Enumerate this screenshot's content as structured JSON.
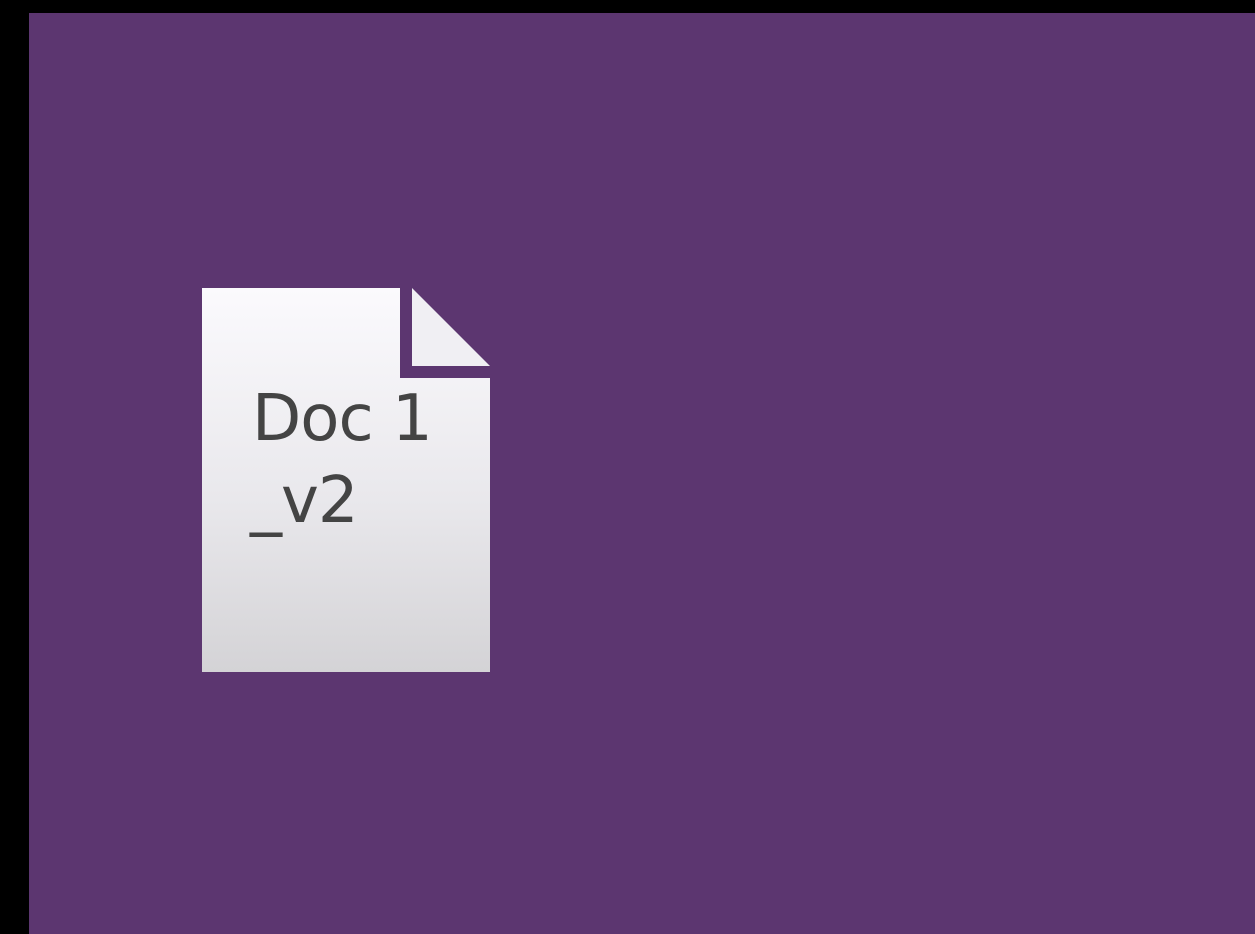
{
  "desktop": {
    "background_color": "#5c3670",
    "frame_color": "#000000"
  },
  "file": {
    "icon": "document-icon",
    "name_line1": "Doc 1",
    "name_line2": "_v2",
    "label_color": "#444444",
    "fold_color": "#5c3670"
  }
}
